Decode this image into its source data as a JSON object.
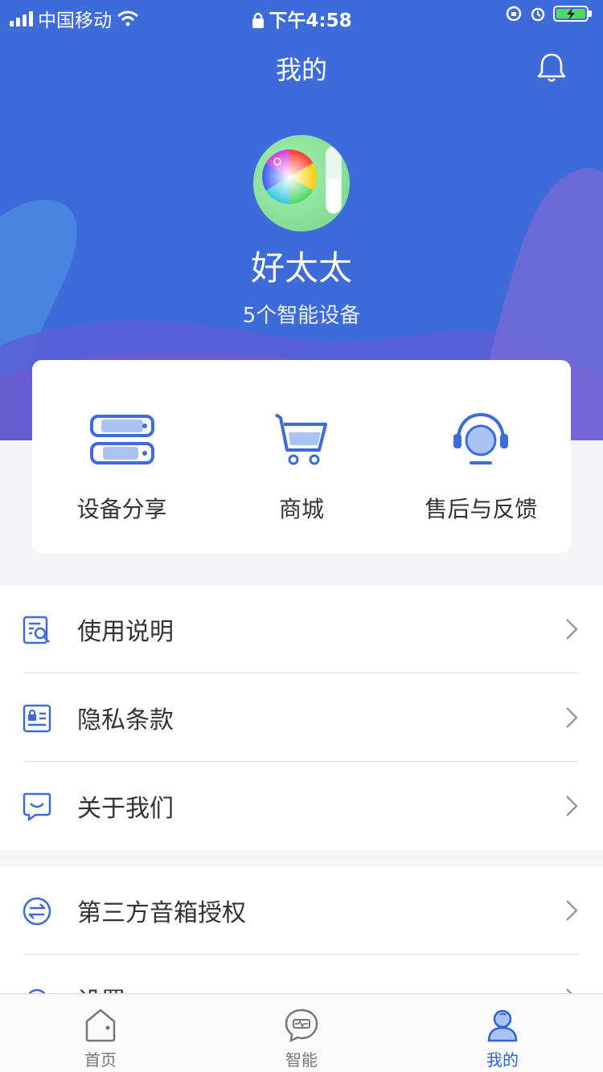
{
  "status_bar": {
    "carrier": "中国移动",
    "time": "下午4:58"
  },
  "header": {
    "title": "我的"
  },
  "profile": {
    "nickname": "好太太",
    "device_count": "5个智能设备"
  },
  "quick_actions": [
    {
      "label": "设备分享",
      "icon": "device-share-icon"
    },
    {
      "label": "商城",
      "icon": "cart-icon"
    },
    {
      "label": "售后与反馈",
      "icon": "headset-icon"
    }
  ],
  "menu_group_1": [
    {
      "label": "使用说明",
      "icon": "manual-search-icon"
    },
    {
      "label": "隐私条款",
      "icon": "privacy-lock-icon"
    },
    {
      "label": "关于我们",
      "icon": "chat-bubble-icon"
    }
  ],
  "menu_group_2": [
    {
      "label": "第三方音箱授权",
      "icon": "swap-icon"
    },
    {
      "label": "设置",
      "icon": "settings-icon"
    }
  ],
  "tab_bar": [
    {
      "label": "首页",
      "icon": "home-icon",
      "active": false
    },
    {
      "label": "智能",
      "icon": "smart-chat-icon",
      "active": false
    },
    {
      "label": "我的",
      "icon": "user-icon",
      "active": true
    }
  ],
  "colors": {
    "primary": "#3d6bd9",
    "accent_active": "#2f63d8",
    "background": "#f5f5f7"
  }
}
